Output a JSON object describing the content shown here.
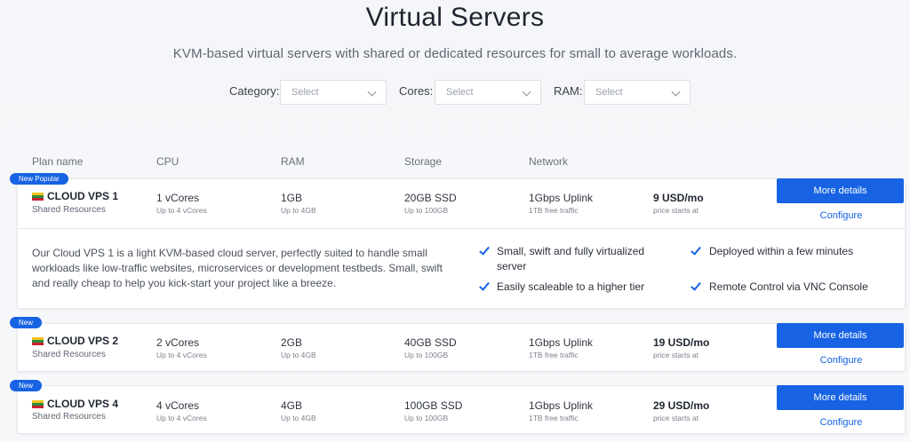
{
  "header": {
    "title": "Virtual Servers",
    "subtitle": "KVM-based virtual servers with shared or dedicated resources for small to average workloads."
  },
  "filters": [
    {
      "label": "Category:",
      "placeholder": "Select"
    },
    {
      "label": "Cores:",
      "placeholder": "Select"
    },
    {
      "label": "RAM:",
      "placeholder": "Select"
    }
  ],
  "columns": [
    "Plan name",
    "CPU",
    "RAM",
    "Storage",
    "Network"
  ],
  "plans": [
    {
      "badge": "New Popular",
      "name": "CLOUD VPS 1",
      "type": "Shared Resources",
      "cpu": "1 vCores",
      "cpu_sub": "Up to 4 vCores",
      "ram": "1GB",
      "ram_sub": "Up to 4GB",
      "storage": "20GB SSD",
      "storage_sub": "Up to 100GB",
      "network": "1Gbps Uplink",
      "network_sub": "1TB free traffic",
      "price": "9 USD/mo",
      "price_sub": "price starts at",
      "details_label": "More details",
      "configure_label": "Configure",
      "description": "Our Cloud VPS 1 is a light KVM-based cloud server, perfectly suited to handle small workloads like low-traffic websites, microservices or development testbeds. Small, swift and really cheap to help you kick-start your project like a breeze.",
      "features": [
        "Small, swift and fully virtualized server",
        "Deployed within a few minutes",
        "Easily scaleable to a higher tier",
        "Remote Control via VNC Console"
      ]
    },
    {
      "badge": "New",
      "name": "CLOUD VPS 2",
      "type": "Shared Resources",
      "cpu": "2 vCores",
      "cpu_sub": "Up to 4 vCores",
      "ram": "2GB",
      "ram_sub": "Up to 4GB",
      "storage": "40GB SSD",
      "storage_sub": "Up to 100GB",
      "network": "1Gbps Uplink",
      "network_sub": "1TB free traffic",
      "price": "19 USD/mo",
      "price_sub": "price starts at",
      "details_label": "More details",
      "configure_label": "Configure"
    },
    {
      "badge": "New",
      "name": "CLOUD VPS 4",
      "type": "Shared Resources",
      "cpu": "4 vCores",
      "cpu_sub": "Up to 4 vCores",
      "ram": "4GB",
      "ram_sub": "Up to 4GB",
      "storage": "100GB SSD",
      "storage_sub": "Up to 100GB",
      "network": "1Gbps Uplink",
      "network_sub": "1TB free traffic",
      "price": "29 USD/mo",
      "price_sub": "price starts at",
      "details_label": "More details",
      "configure_label": "Configure"
    }
  ],
  "colors": {
    "accent": "#1763e3",
    "background": "#f5f6f9",
    "card": "#ffffff"
  }
}
